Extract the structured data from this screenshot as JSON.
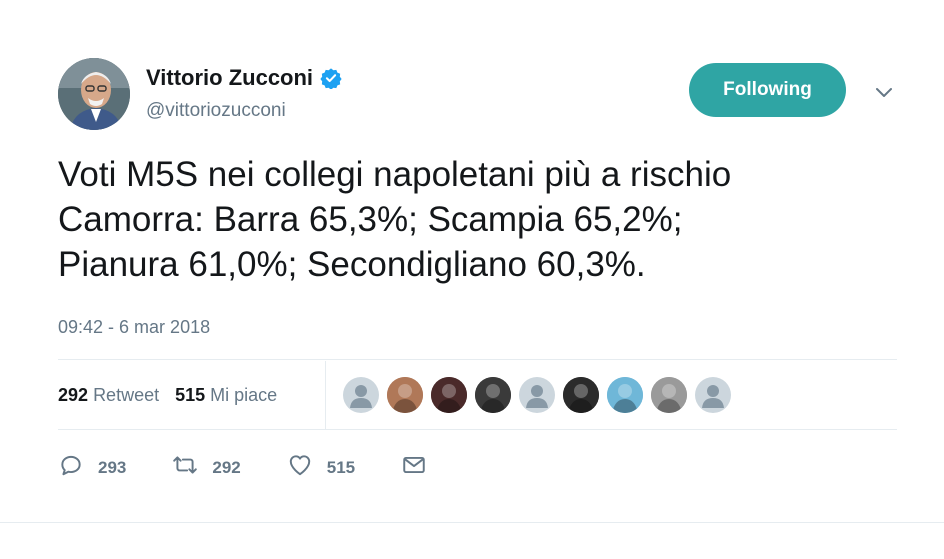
{
  "author": {
    "name": "Vittorio Zucconi",
    "handle": "@vittoriozucconi",
    "verified": true
  },
  "follow_button": {
    "label": "Following",
    "color": "#2fa5a4"
  },
  "tweet": {
    "text": "Voti M5S nei collegi napoletani più a rischio\nCamorra: Barra 65,3%; Scampia 65,2%;\nPianura 61,0%; Secondigliano 60,3%.",
    "timestamp": "09:42 - 6 mar 2018"
  },
  "stats": {
    "retweets": {
      "count": "292",
      "label": "Retweet"
    },
    "likes": {
      "count": "515",
      "label": "Mi piace"
    }
  },
  "likers": [
    {
      "type": "default"
    },
    {
      "type": "photo",
      "color": "#b07858"
    },
    {
      "type": "photo",
      "color": "#4a2a2a"
    },
    {
      "type": "photo",
      "color": "#3a3a3a"
    },
    {
      "type": "default"
    },
    {
      "type": "photo",
      "color": "#2b2b2b"
    },
    {
      "type": "photo",
      "color": "#6fb7d8"
    },
    {
      "type": "photo",
      "color": "#9a9a9a"
    },
    {
      "type": "default"
    }
  ],
  "actions": {
    "reply": {
      "icon": "reply-icon",
      "count": "293"
    },
    "retweet": {
      "icon": "retweet-icon",
      "count": "292"
    },
    "like": {
      "icon": "heart-icon",
      "count": "515"
    },
    "dm": {
      "icon": "envelope-icon"
    }
  }
}
